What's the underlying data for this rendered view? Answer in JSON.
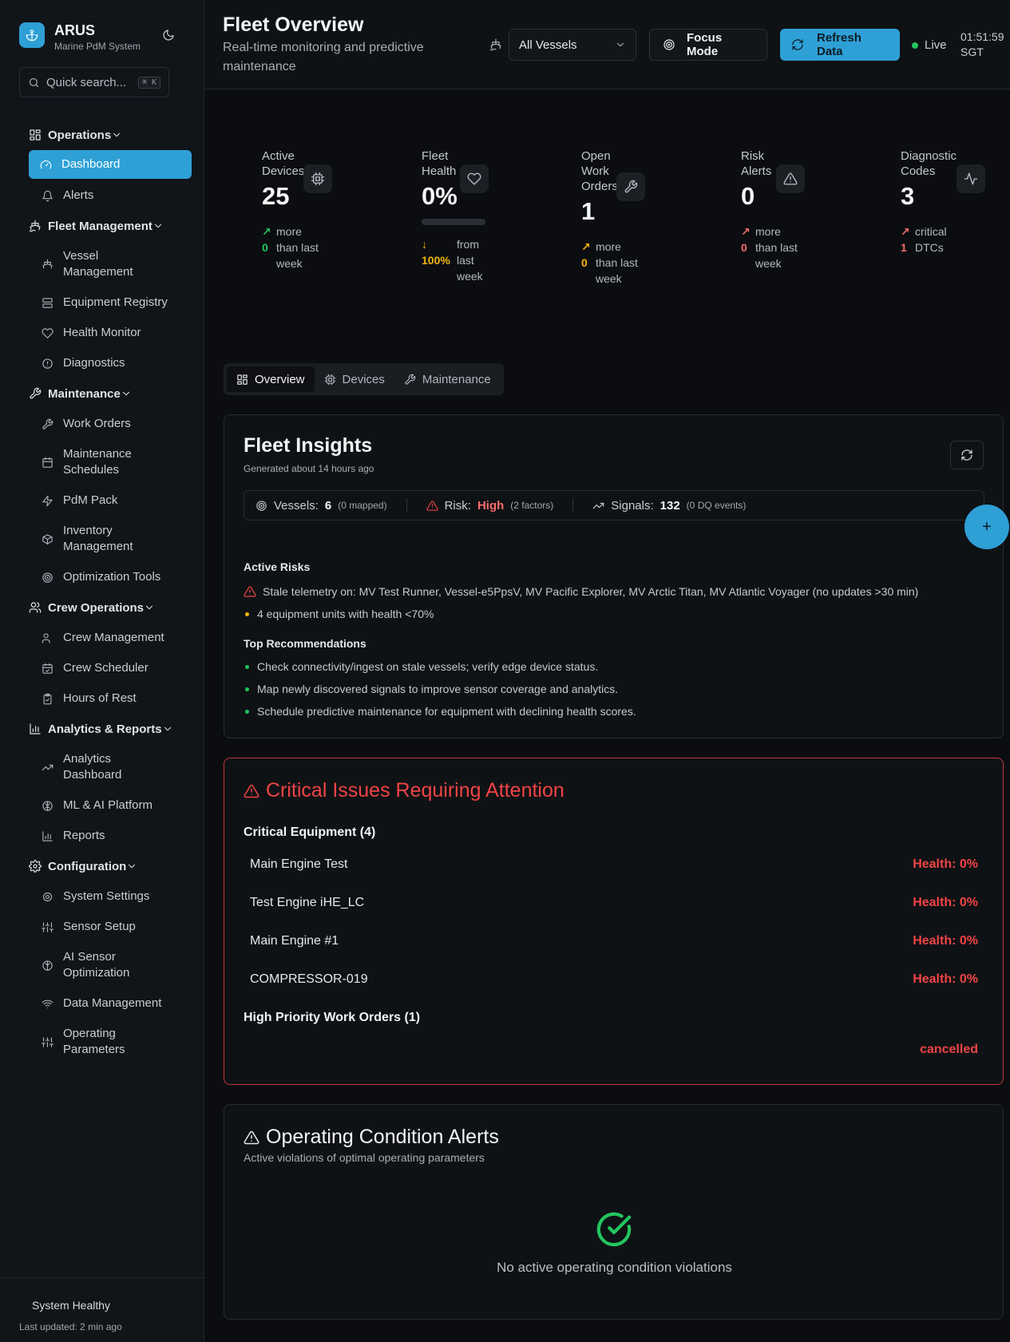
{
  "brand": {
    "name": "ARUS",
    "subtitle": "Marine PdM System"
  },
  "search": {
    "placeholder": "Quick search...",
    "shortcut": "⌘ K"
  },
  "nav": {
    "operations": {
      "label": "Operations",
      "items": [
        "Dashboard",
        "Alerts"
      ]
    },
    "fleet": {
      "label": "Fleet Management",
      "items": [
        "Vessel Management",
        "Equipment Registry",
        "Health Monitor",
        "Diagnostics"
      ]
    },
    "maintenance": {
      "label": "Maintenance",
      "items": [
        "Work Orders",
        "Maintenance Schedules",
        "PdM Pack",
        "Inventory Management",
        "Optimization Tools"
      ]
    },
    "crew": {
      "label": "Crew Operations",
      "items": [
        "Crew Management",
        "Crew Scheduler",
        "Hours of Rest"
      ]
    },
    "analytics": {
      "label": "Analytics & Reports",
      "items": [
        "Analytics Dashboard",
        "ML & AI Platform",
        "Reports"
      ]
    },
    "config": {
      "label": "Configuration",
      "items": [
        "System Settings",
        "Sensor Setup",
        "AI Sensor Optimization",
        "Data Management",
        "Operating Parameters"
      ]
    }
  },
  "footer": {
    "status": "System Healthy",
    "updated": "Last updated: 2 min ago"
  },
  "header": {
    "title": "Fleet Overview",
    "subtitle": "Real-time monitoring and predictive maintenance",
    "vessel_select": "All Vessels",
    "focus_mode": "Focus Mode",
    "refresh": "Refresh Data",
    "live": "Live",
    "time": "01:51:59",
    "tz": "SGT"
  },
  "stats": {
    "active_devices": {
      "label": "Active Devices",
      "value": "25",
      "delta": "0",
      "delta_text": "more than last week"
    },
    "fleet_health": {
      "label": "Fleet Health",
      "value": "0%",
      "delta": "100%",
      "delta_text": "from last week",
      "progress": 0
    },
    "open_work_orders": {
      "label": "Open Work Orders",
      "value": "1",
      "delta": "0",
      "delta_text": "more than last week"
    },
    "risk_alerts": {
      "label": "Risk Alerts",
      "value": "0",
      "delta": "0",
      "delta_text": "more than last week"
    },
    "diagnostic_codes": {
      "label": "Diagnostic Codes",
      "value": "3",
      "delta": "1",
      "delta_text": "critical DTCs"
    }
  },
  "tabs": [
    "Overview",
    "Devices",
    "Maintenance"
  ],
  "insights": {
    "title": "Fleet Insights",
    "generated": "Generated about 14 hours ago",
    "vessels_label": "Vessels:",
    "vessels_value": "6",
    "vessels_note": "(0 mapped)",
    "risk_label": "Risk:",
    "risk_value": "High",
    "risk_note": "(2 factors)",
    "signals_label": "Signals:",
    "signals_value": "132",
    "signals_note": "(0 DQ events)",
    "active_risks_title": "Active Risks",
    "risks": [
      "Stale telemetry on: MV Test Runner, Vessel-e5PpsV, MV Pacific Explorer, MV Arctic Titan, MV Atlantic Voyager (no updates >30 min)",
      "4 equipment units with health <70%"
    ],
    "recommendations_title": "Top Recommendations",
    "recommendations": [
      "Check connectivity/ingest on stale vessels; verify edge device status.",
      "Map newly discovered signals to improve sensor coverage and analytics.",
      "Schedule predictive maintenance for equipment with declining health scores."
    ]
  },
  "critical": {
    "title": "Critical Issues Requiring Attention",
    "equipment_title": "Critical Equipment (4)",
    "equipment": [
      {
        "name": "Main Engine Test",
        "health": "Health: 0%"
      },
      {
        "name": "Test Engine iHE_LC",
        "health": "Health: 0%"
      },
      {
        "name": "Main Engine #1",
        "health": "Health: 0%"
      },
      {
        "name": "COMPRESSOR-019",
        "health": "Health: 0%"
      }
    ],
    "work_orders_title": "High Priority Work Orders (1)",
    "work_order_status": "cancelled"
  },
  "operating": {
    "title": "Operating Condition Alerts",
    "subtitle": "Active violations of optimal operating parameters",
    "empty": "No active operating condition violations"
  },
  "fab": "+",
  "colors": {
    "accent": "#2ea0d6",
    "critical": "#ef4444",
    "ok": "#22c55e",
    "warn": "#f5b50a"
  }
}
